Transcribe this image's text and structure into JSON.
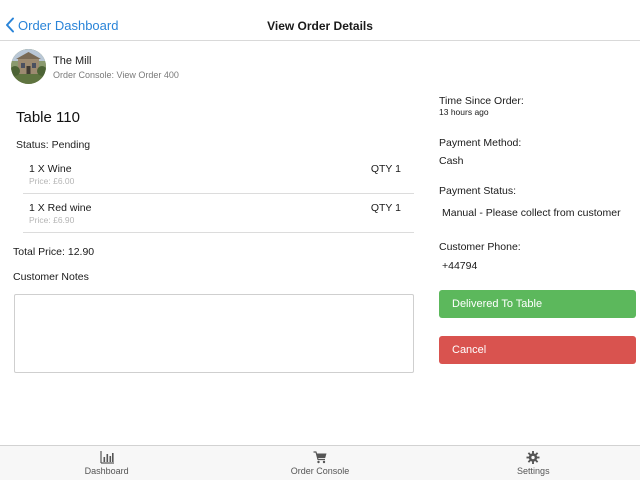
{
  "nav": {
    "back_label": "Order Dashboard",
    "title": "View Order Details"
  },
  "venue": {
    "name": "The Mill",
    "subtitle": "Order Console: View Order 400"
  },
  "order": {
    "table": "Table 110",
    "status": "Status: Pending",
    "items": [
      {
        "name": "1 X Wine",
        "price": "Price: £6.00",
        "qty": "QTY 1"
      },
      {
        "name": "1 X Red wine",
        "price": "Price: £6.90",
        "qty": "QTY 1"
      }
    ],
    "total": "Total Price: 12.90",
    "notes_label": "Customer Notes",
    "notes_value": ""
  },
  "info": {
    "time_label": "Time Since Order:",
    "time_value": "13 hours ago",
    "payment_method_label": "Payment Method:",
    "payment_method_value": "Cash",
    "payment_status_label": "Payment Status:",
    "payment_status_value": "Manual - Please collect from customer",
    "phone_label": "Customer Phone:",
    "phone_value": "+44794"
  },
  "actions": {
    "delivered_label": "Delivered To Table",
    "cancel_label": "Cancel"
  },
  "tabs": [
    {
      "label": "Dashboard",
      "icon": "bar-chart-icon"
    },
    {
      "label": "Order Console",
      "icon": "cart-icon"
    },
    {
      "label": "Settings",
      "icon": "gear-icon"
    }
  ],
  "colors": {
    "accent": "#2a84d8",
    "success": "#5cb85c",
    "danger": "#d9534f"
  }
}
